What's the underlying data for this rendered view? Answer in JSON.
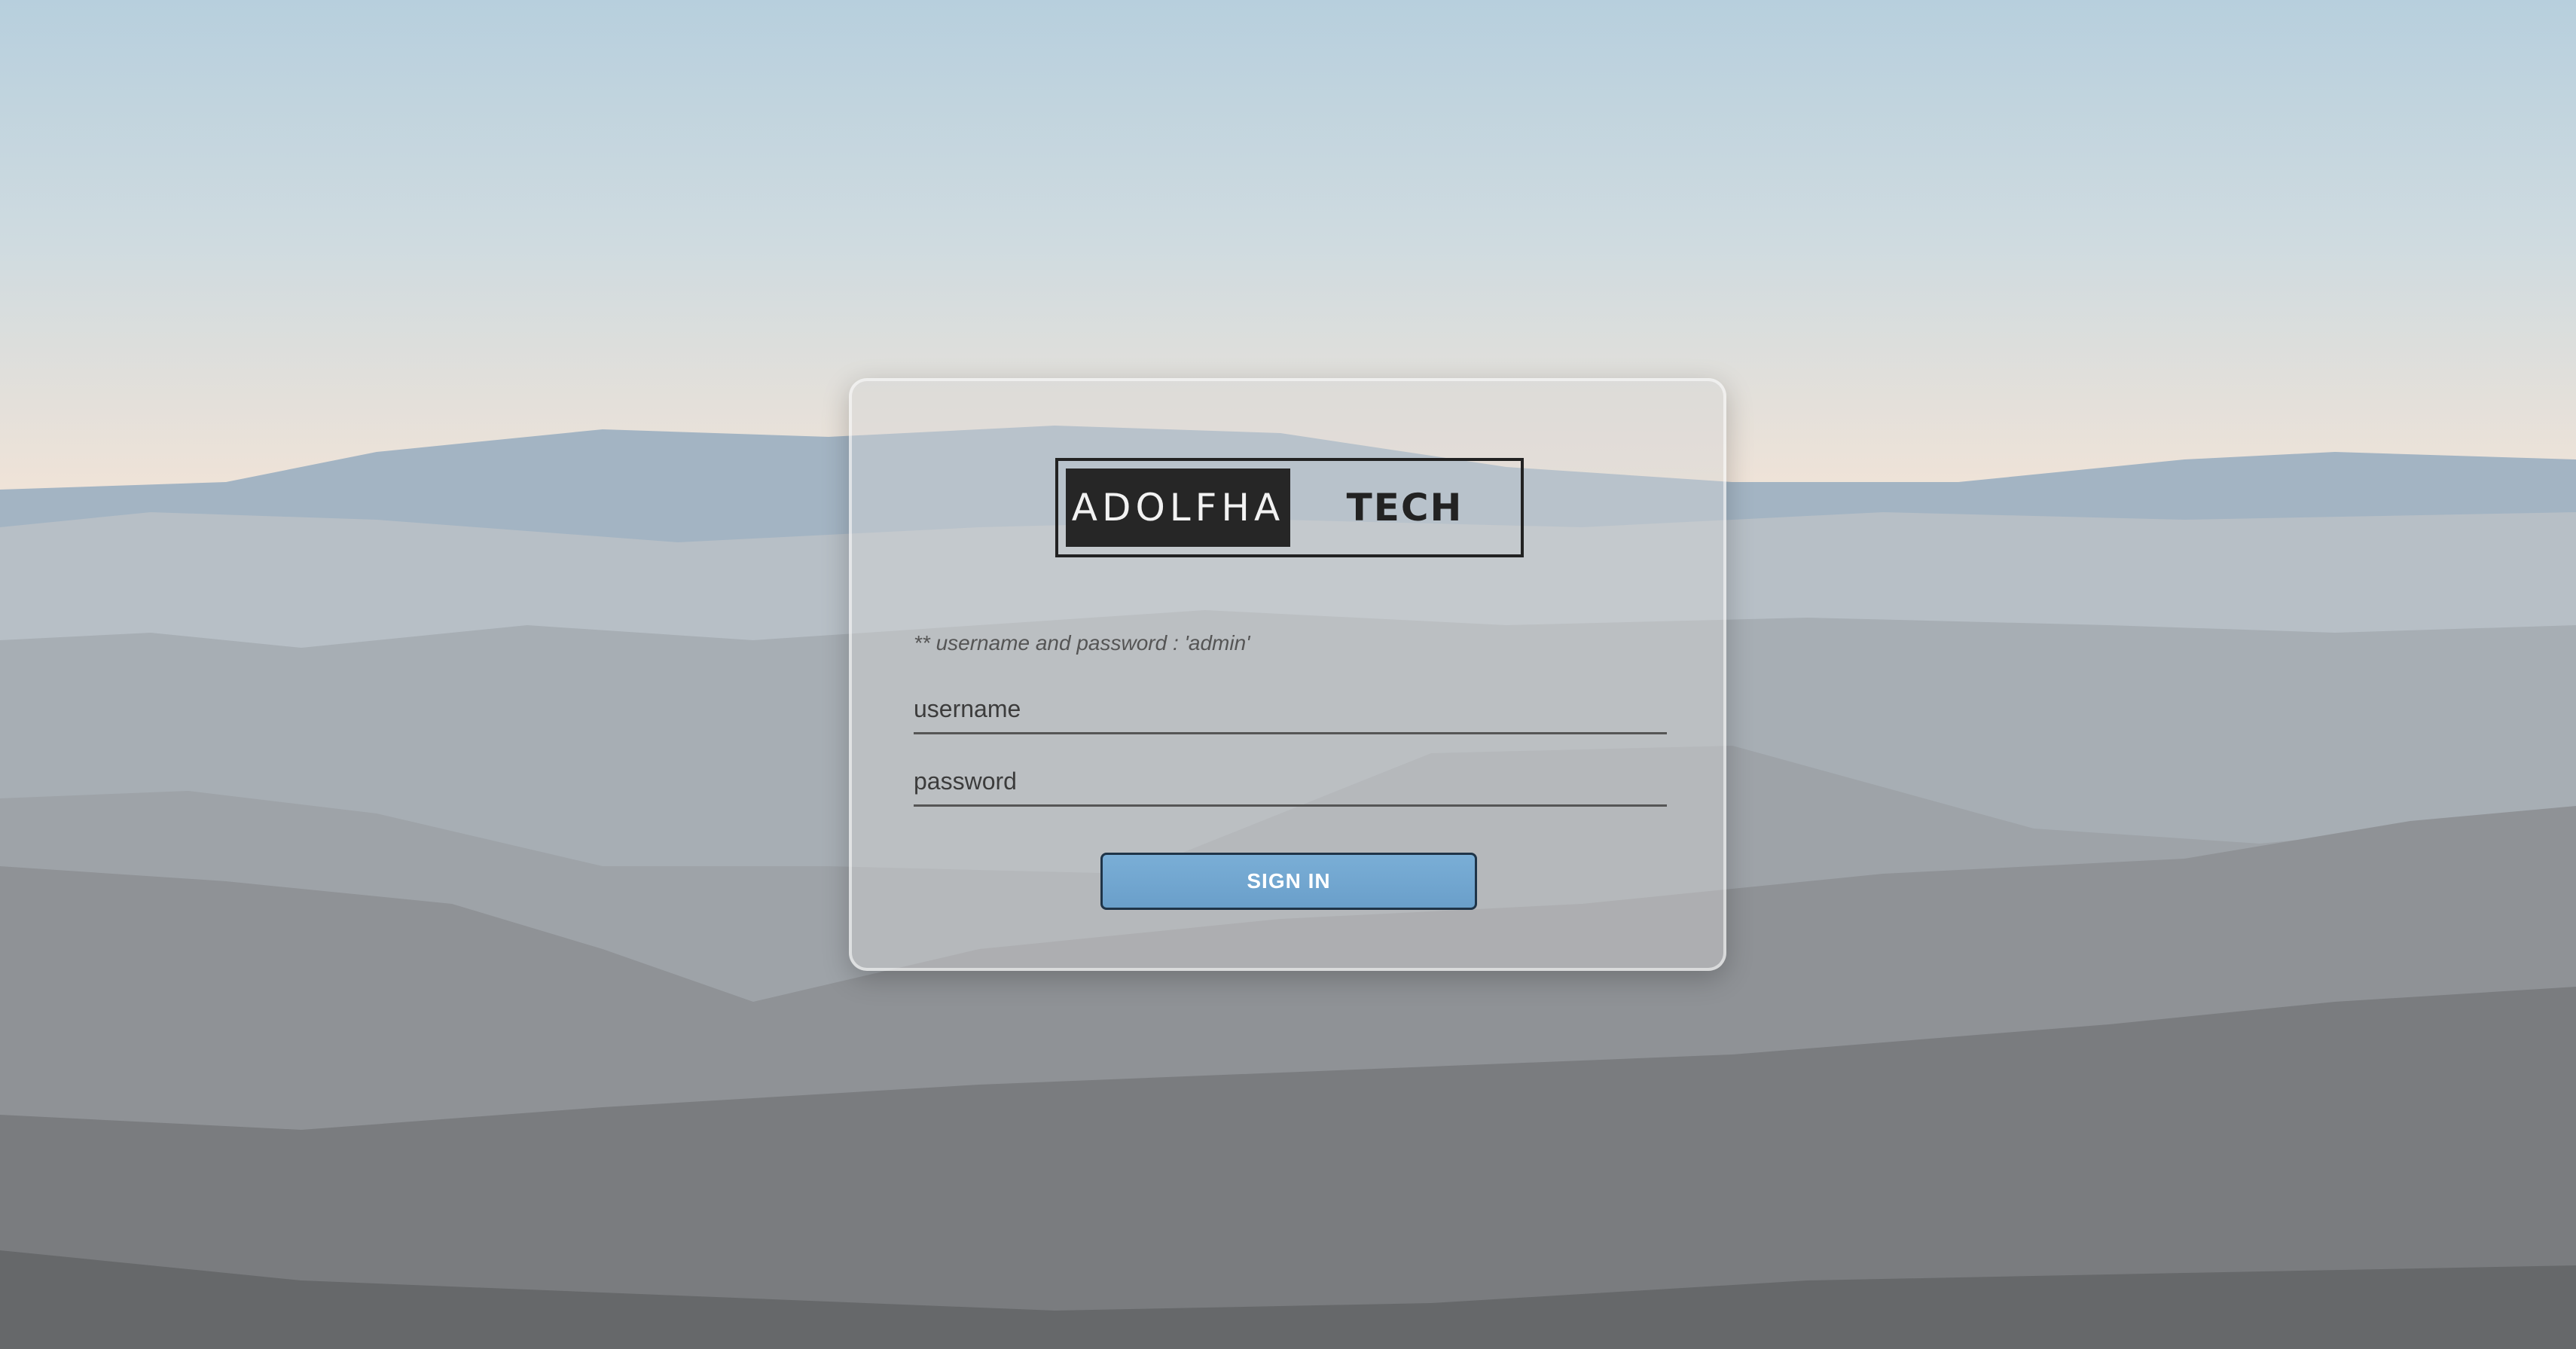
{
  "logo": {
    "left_text": "ADOLFHA",
    "right_text": "TECH"
  },
  "login": {
    "hint": "** username and password : 'admin'",
    "username_placeholder": "username",
    "username_value": "",
    "password_placeholder": "password",
    "password_value": "",
    "submit_label": "SIGN IN"
  },
  "colors": {
    "button": "#6fa5d0",
    "logo_dark": "#262626"
  }
}
